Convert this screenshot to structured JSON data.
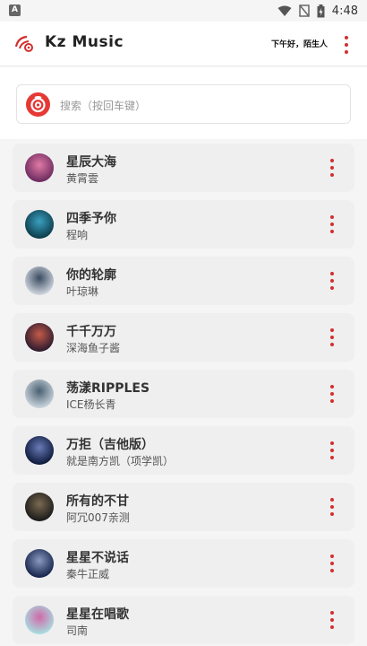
{
  "status_bar": {
    "app_icon_letter": "A",
    "time": "4:48",
    "icons": [
      "wifi-icon",
      "signal-off-icon",
      "battery-icon"
    ]
  },
  "app_bar": {
    "title": "Kz Music",
    "greeting": "下午好，陌生人",
    "logo_icon": "music-logo-icon",
    "menu_icon": "more-vert-icon"
  },
  "search": {
    "placeholder": "搜索（按回车键）",
    "icon": "netease-logo-icon"
  },
  "colors": {
    "accent": "#d32f2f",
    "background": "#f5f5f5",
    "card": "#efefef"
  },
  "songs": [
    {
      "title": "星辰大海",
      "artist": "黄霄雲",
      "cover": [
        "#6b2a5e",
        "#e07aa5"
      ]
    },
    {
      "title": "四季予你",
      "artist": "程响",
      "cover": [
        "#0d3b4a",
        "#3aa0c0"
      ]
    },
    {
      "title": "你的轮廓",
      "artist": "叶琼琳",
      "cover": [
        "#cfd6df",
        "#3a4a60"
      ]
    },
    {
      "title": "千千万万",
      "artist": "深海鱼子酱",
      "cover": [
        "#2b1a2e",
        "#c45a4a"
      ]
    },
    {
      "title": "荡漾RIPPLES",
      "artist": "ICE杨长青",
      "cover": [
        "#c9d4dc",
        "#4a6072"
      ]
    },
    {
      "title": "万拒（吉他版）",
      "artist": "就是南方凯（项学凯）",
      "cover": [
        "#0c1a3a",
        "#6a7ab8"
      ]
    },
    {
      "title": "所有的不甘",
      "artist": "阿冗007亲测",
      "cover": [
        "#1a1a1a",
        "#7a6a50"
      ]
    },
    {
      "title": "星星不说话",
      "artist": "秦牛正威",
      "cover": [
        "#15234a",
        "#8a9ac0"
      ]
    },
    {
      "title": "星星在唱歌",
      "artist": "司南",
      "cover": [
        "#a8dde0",
        "#d06aa8"
      ]
    }
  ]
}
